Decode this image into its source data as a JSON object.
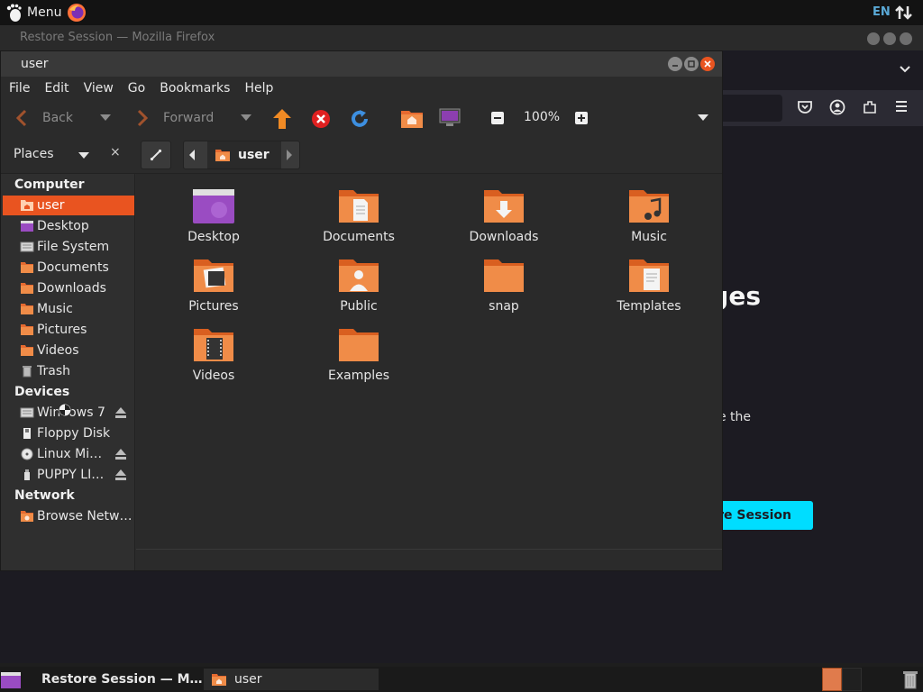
{
  "top_panel": {
    "menu_label": "Menu",
    "lang": "EN"
  },
  "firefox": {
    "window_title": "Restore Session — Mozilla Firefox",
    "heading_partial": "ges",
    "body_partial": "e the",
    "restore_button_partial": "ore Session",
    "accent_color": "#00ddff"
  },
  "file_manager": {
    "window_title": "user",
    "menu": [
      "File",
      "Edit",
      "View",
      "Go",
      "Bookmarks",
      "Help"
    ],
    "toolbar": {
      "back_label": "Back",
      "forward_label": "Forward",
      "zoom_level": "100%"
    },
    "places_label": "Places",
    "path_crumb": "user",
    "sidebar": {
      "computer_header": "Computer",
      "computer_items": [
        {
          "label": "user",
          "icon": "home-folder-icon",
          "active": true
        },
        {
          "label": "Desktop",
          "icon": "desktop-icon"
        },
        {
          "label": "File System",
          "icon": "drive-icon"
        },
        {
          "label": "Documents",
          "icon": "folder-icon"
        },
        {
          "label": "Downloads",
          "icon": "folder-icon"
        },
        {
          "label": "Music",
          "icon": "folder-icon"
        },
        {
          "label": "Pictures",
          "icon": "folder-icon"
        },
        {
          "label": "Videos",
          "icon": "folder-icon"
        },
        {
          "label": "Trash",
          "icon": "trash-icon"
        }
      ],
      "devices_header": "Devices",
      "device_items": [
        {
          "label": "Windows 7",
          "icon": "drive-icon",
          "eject": true
        },
        {
          "label": "Floppy Disk",
          "icon": "floppy-icon",
          "eject": false
        },
        {
          "label": "Linux Mi…",
          "icon": "cdrom-icon",
          "eject": true
        },
        {
          "label": "PUPPY LI…",
          "icon": "usb-icon",
          "eject": true
        }
      ],
      "network_header": "Network",
      "network_items": [
        {
          "label": "Browse Netw…",
          "icon": "network-icon"
        }
      ]
    },
    "files": [
      {
        "label": "Desktop",
        "icon": "desktop-folder-icon"
      },
      {
        "label": "Documents",
        "icon": "documents-folder-icon"
      },
      {
        "label": "Downloads",
        "icon": "downloads-folder-icon"
      },
      {
        "label": "Music",
        "icon": "music-folder-icon"
      },
      {
        "label": "Pictures",
        "icon": "pictures-folder-icon"
      },
      {
        "label": "Public",
        "icon": "public-folder-icon"
      },
      {
        "label": "snap",
        "icon": "folder-icon"
      },
      {
        "label": "Templates",
        "icon": "templates-folder-icon"
      },
      {
        "label": "Videos",
        "icon": "videos-folder-icon"
      },
      {
        "label": "Examples",
        "icon": "folder-icon"
      }
    ],
    "accent_color": "#e95420",
    "folder_color": "#f08c48"
  },
  "taskbar": {
    "tasks": [
      {
        "label": "Restore Session — M…",
        "icon": "firefox-icon"
      },
      {
        "label": "user",
        "icon": "home-folder-icon"
      }
    ]
  }
}
